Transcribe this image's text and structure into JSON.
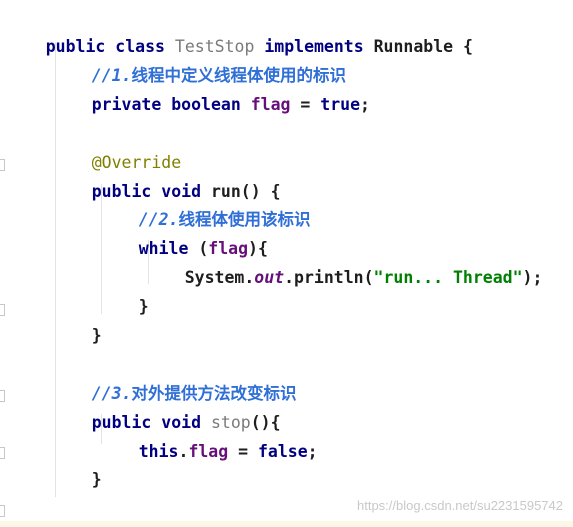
{
  "code": {
    "l1": {
      "a": "public",
      "b": "class",
      "c": "TestStop",
      "d": "implements",
      "e": "Runnable {"
    },
    "l2": {
      "prefix": "//1.",
      "text": "线程中定义线程体使用的标识"
    },
    "l3": {
      "a": "private",
      "b": "boolean",
      "c": "flag",
      "d": " = ",
      "e": "true",
      "f": ";"
    },
    "l5": {
      "text": "@Override"
    },
    "l6": {
      "a": "public",
      "b": "void",
      "c": "run() {"
    },
    "l7": {
      "prefix": "//2.",
      "text": "线程体使用该标识"
    },
    "l8": {
      "a": "while",
      "b": " (",
      "c": "flag",
      "d": "){"
    },
    "l9": {
      "a": "System.",
      "b": "out",
      "c": ".println(",
      "d": "\"run... Thread\"",
      "e": ");"
    },
    "l10": {
      "text": "}"
    },
    "l11": {
      "text": "}"
    },
    "l13": {
      "prefix": "//3.",
      "text": "对外提供方法改变标识"
    },
    "l14": {
      "a": "public",
      "b": "void",
      "c": "stop",
      "d": "(){"
    },
    "l15": {
      "a": "this",
      "b": ".",
      "c": "flag",
      "d": " = ",
      "e": "false",
      "f": ";"
    },
    "l16": {
      "text": "}"
    },
    "l18": {
      "text": "}"
    }
  },
  "watermark": "https://blog.csdn.net/su2231595742",
  "colors": {
    "keyword": "#000080",
    "field": "#660e7a",
    "string": "#008000",
    "annotation": "#808000",
    "comment": "#2f6fd6"
  }
}
